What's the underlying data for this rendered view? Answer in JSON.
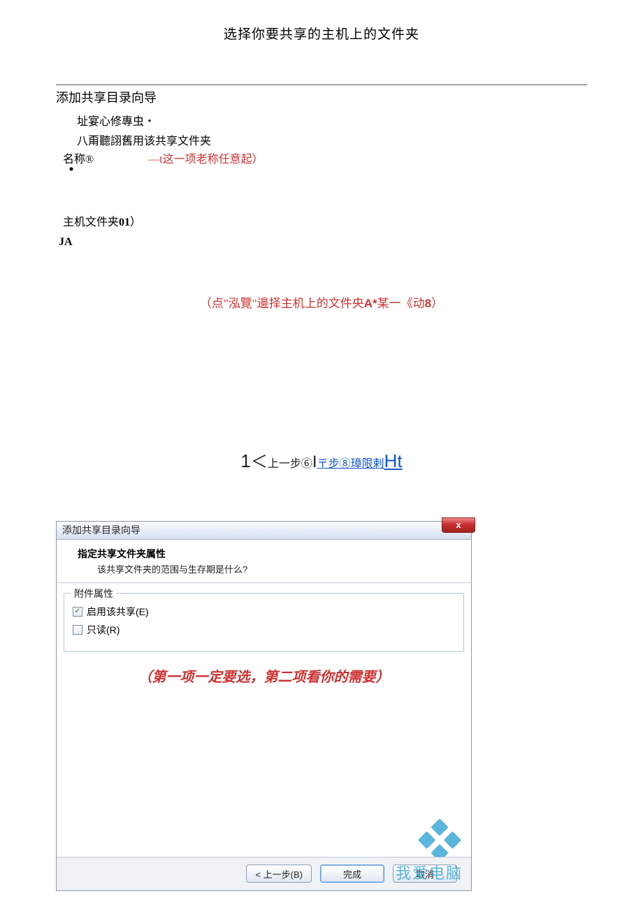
{
  "page_title": "选择你要共享的主机上的文件夹",
  "section1": {
    "title": "添加共享目录向导",
    "line1": "址宴心修專虫・",
    "line2": "八甭聽詡舊用该共享文件夹",
    "name_label": "名称®",
    "name_hint": "—t这一项老称任意起）",
    "dot": "・",
    "host_folder": "主机文件夹01）",
    "ja": "JA",
    "browse_hint_prefix": "（点\"泓覽\"邊择主机上的文件央",
    "browse_hint_mid": "A*",
    "browse_hint_suffix": "某一《动",
    "browse_hint_num": "8",
    "browse_hint_close": "）"
  },
  "nav": {
    "one": "1",
    "lt": "＜",
    "prev": "上一步⑥",
    "pipe": "I",
    "next": "〒步⑧",
    "limit": "璋限剌",
    "ht": "Ht"
  },
  "dialog": {
    "title": "添加共享目录向导",
    "close": "x",
    "heading": "指定共享文件夹属性",
    "subheading": "该共享文件夹的范围与生存期是什么?",
    "group_label": "附件属性",
    "enable_share": "启用该共享(E)",
    "read_only": "只读(R)",
    "red_note": "（第一项一定要选，第二项看你的需要）",
    "btn_back": "< 上一步(B)",
    "btn_finish": "完成",
    "btn_cancel": "取消",
    "watermark_text": "我爱电脑"
  }
}
